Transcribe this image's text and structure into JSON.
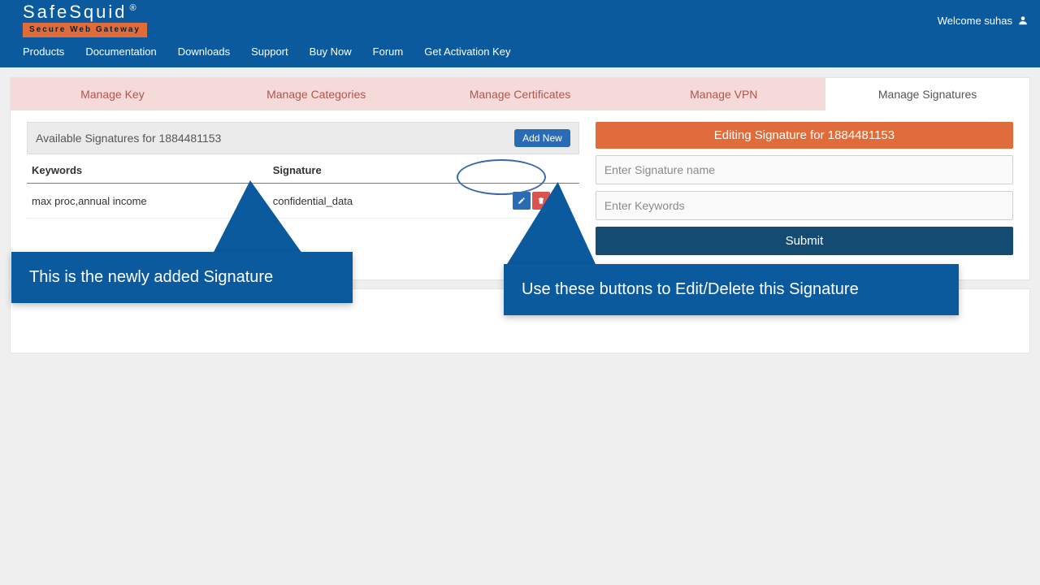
{
  "brand": {
    "name": "SafeSquid",
    "reg": "®",
    "tagline": "Secure Web Gateway"
  },
  "welcome": {
    "text": "Welcome suhas"
  },
  "nav": {
    "products": "Products",
    "documentation": "Documentation",
    "downloads": "Downloads",
    "support": "Support",
    "buy": "Buy Now",
    "forum": "Forum",
    "activation": "Get Activation Key"
  },
  "tabs": {
    "key": "Manage Key",
    "categories": "Manage Categories",
    "certificates": "Manage Certificates",
    "vpn": "Manage VPN",
    "signatures": "Manage Signatures"
  },
  "panel": {
    "title": "Available Signatures for 1884481153",
    "add_new": "Add New",
    "col_keywords": "Keywords",
    "col_signature": "Signature",
    "rows": [
      {
        "keywords": "max proc,annual income",
        "signature": "confidential_data"
      }
    ]
  },
  "editor": {
    "title": "Editing Signature for 1884481153",
    "placeholder_name": "Enter Signature name",
    "placeholder_keywords": "Enter Keywords",
    "submit": "Submit"
  },
  "annotations": {
    "new_signature": "This is the newly added Signature",
    "edit_delete": "Use these buttons to Edit/Delete this Signature"
  },
  "colors": {
    "brand_blue": "#0b5a9e",
    "accent_orange": "#e06c3b",
    "tab_bg": "#f5dada",
    "submit": "#134b73",
    "delete": "#d9534f"
  }
}
